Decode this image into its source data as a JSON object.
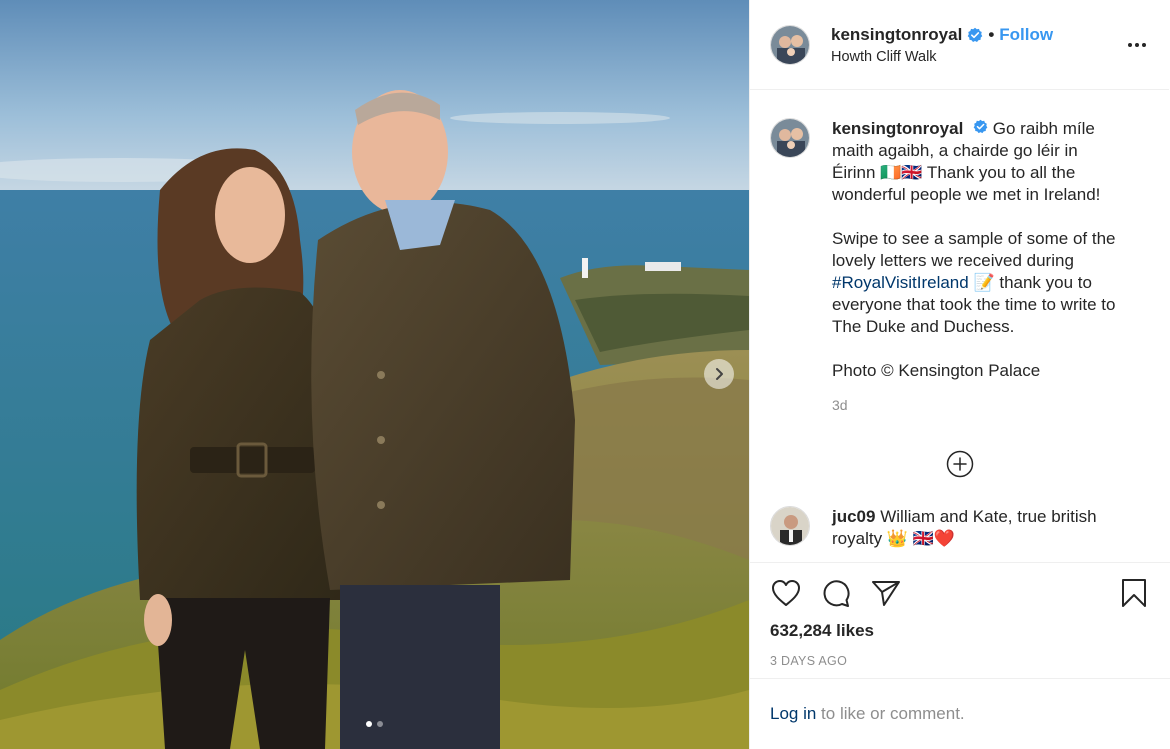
{
  "post": {
    "username": "kensingtonroyal",
    "follow_label": "Follow",
    "separator": "•",
    "location": "Howth Cliff Walk"
  },
  "caption": {
    "username": "kensingtonroyal",
    "line_a": "Go raibh míle maith agaibh, a chairde go léir in Éirinn 🇮🇪🇬🇧 Thank you to all the wonderful people we met in Ireland!",
    "line_b_pre": "Swipe to see a sample of some of the lovely letters we received during",
    "hashtag": "#RoyalVisitIreland",
    "line_b_post": "📝 thank you to everyone that took the time to write to The Duke and Duchess.",
    "line_c": "Photo © Kensington Palace",
    "age": "3d"
  },
  "comments": [
    {
      "username": "juc09",
      "text": "William and Kate, true british royalty 👑 🇬🇧❤️"
    }
  ],
  "engagement": {
    "likes": "632,284 likes",
    "posted": "3 DAYS AGO"
  },
  "footer": {
    "login_link": "Log in",
    "login_rest": " to like or comment."
  },
  "carousel": {
    "slide": 1,
    "total": 2
  },
  "icons": {
    "verified": "verified-badge-icon",
    "more": "more-options-icon",
    "like": "heart-icon",
    "comment": "comment-bubble-icon",
    "share": "paper-plane-icon",
    "save": "bookmark-icon",
    "load": "plus-circle-icon",
    "next": "chevron-right-icon"
  },
  "colors": {
    "link_blue": "#3897f0",
    "hashtag": "#00376b",
    "muted": "#8e8e8e",
    "verified": "#3897f0"
  }
}
